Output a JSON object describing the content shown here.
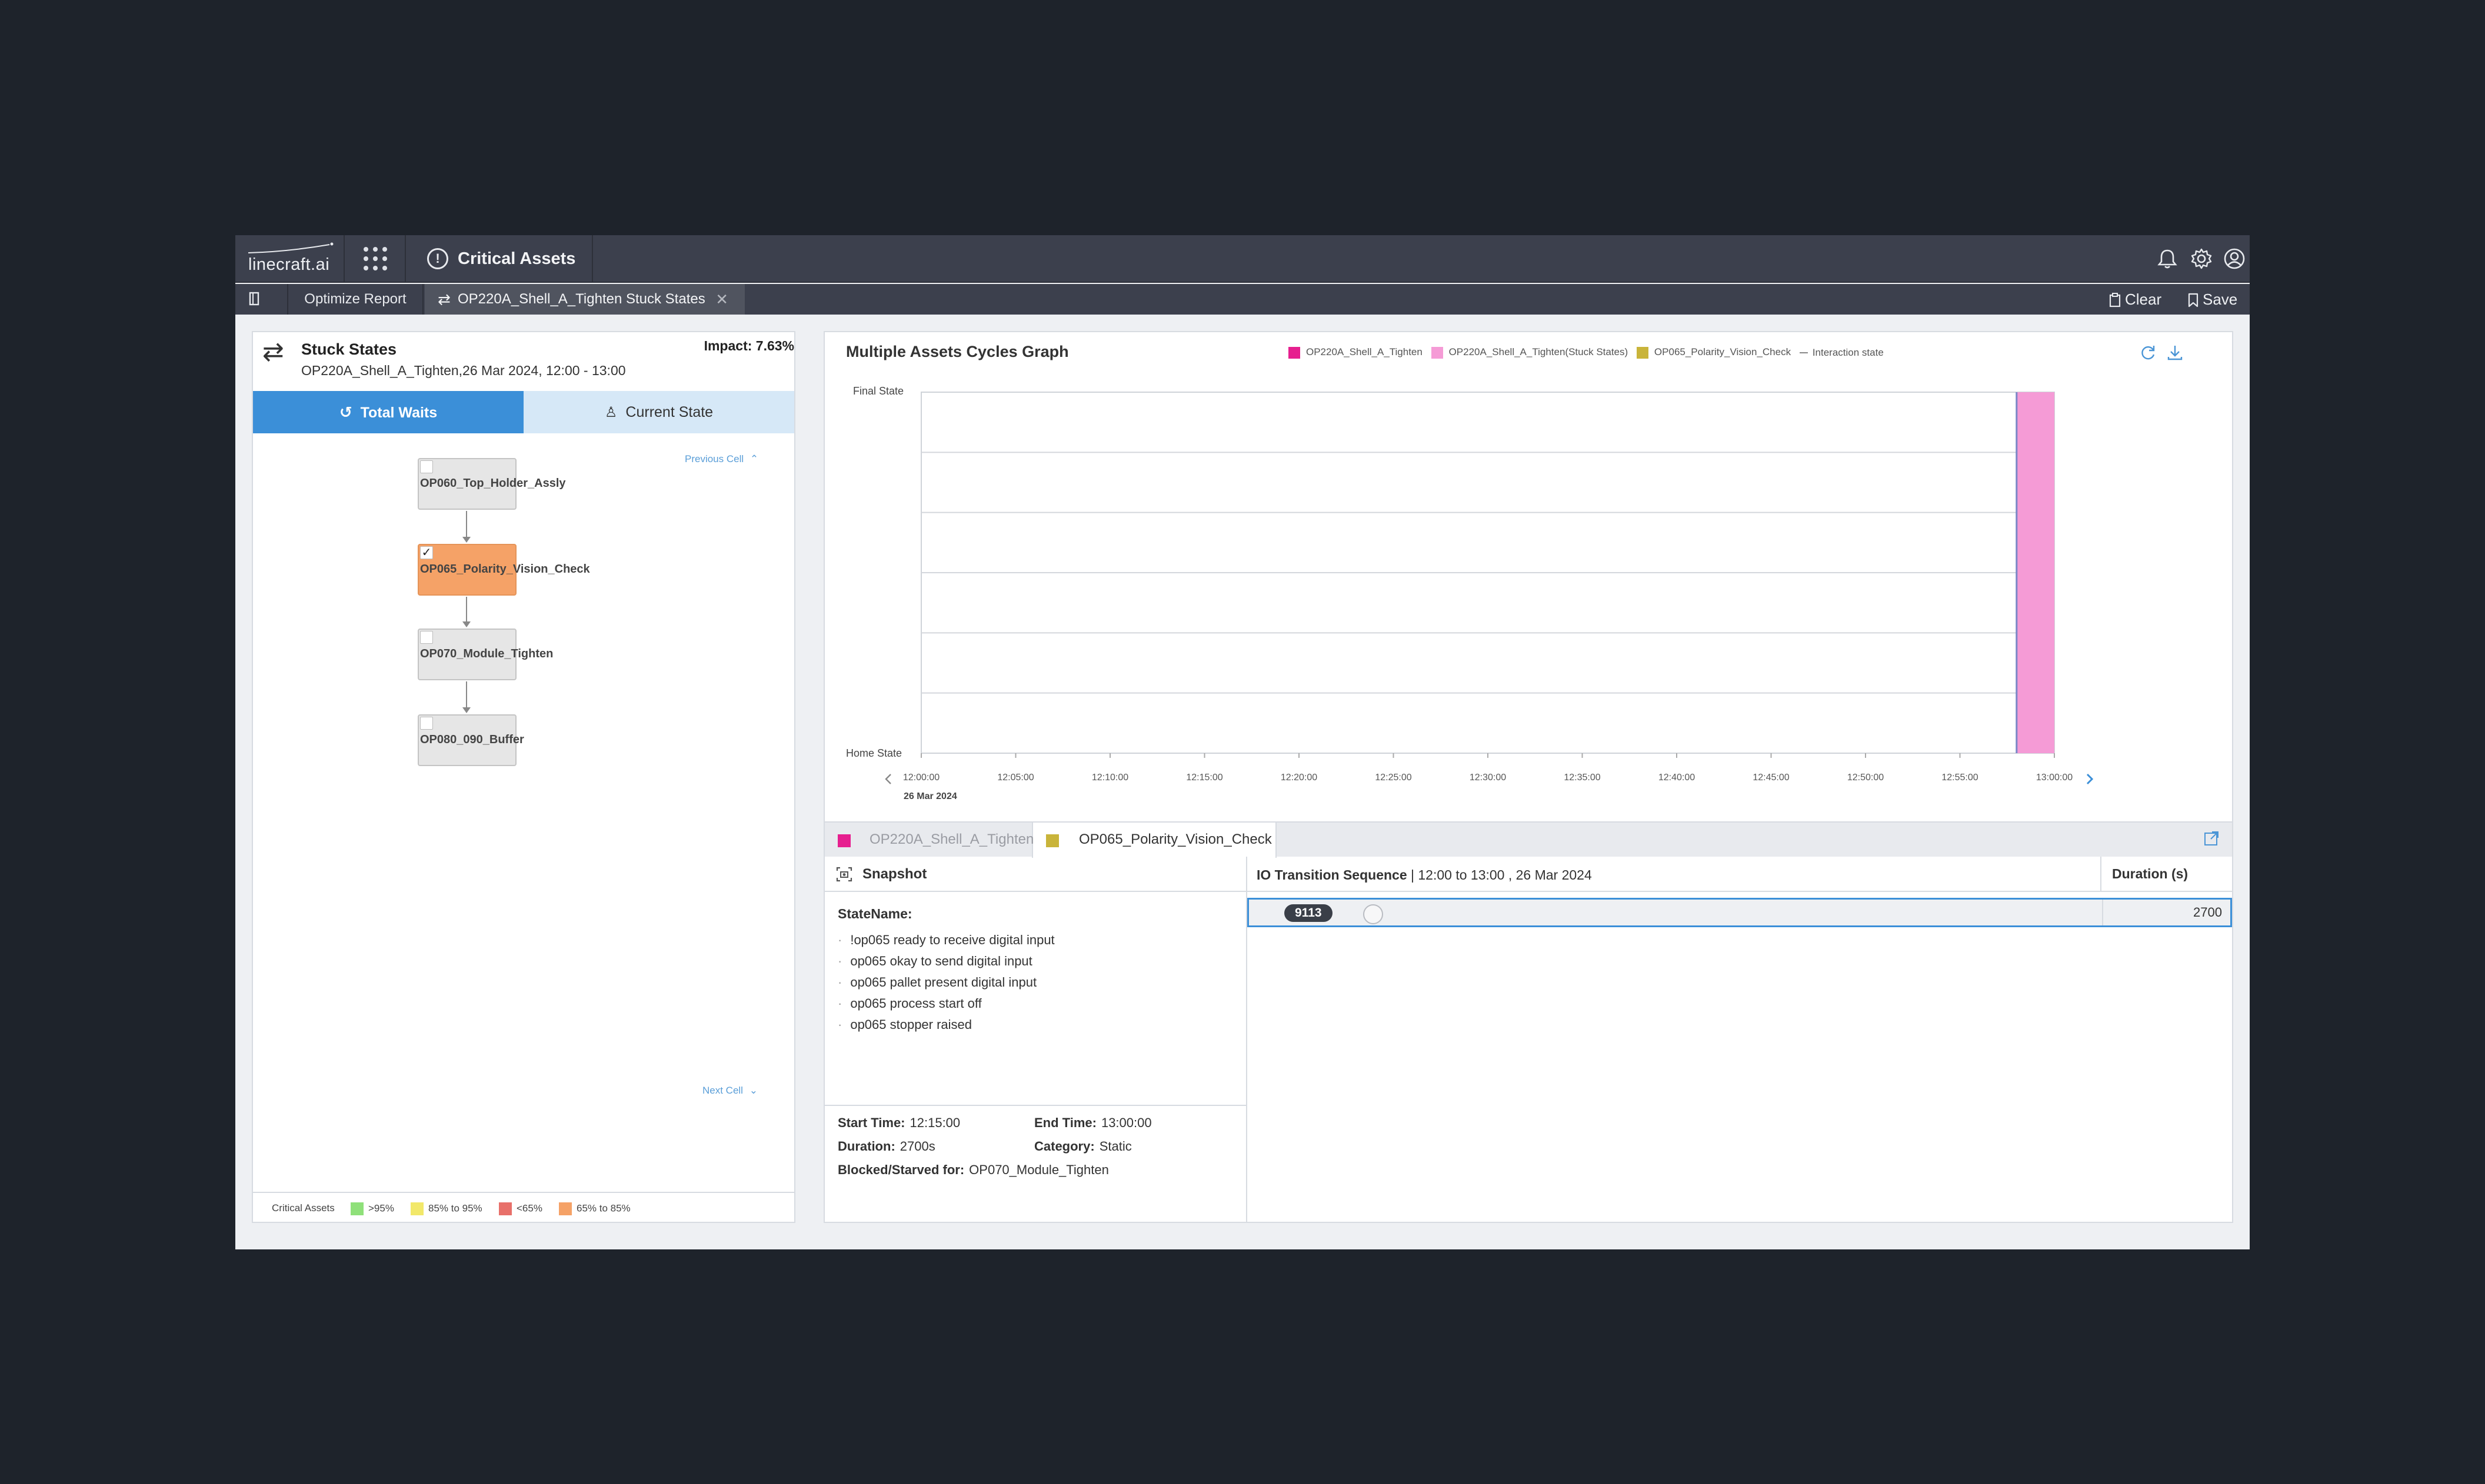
{
  "app": {
    "logo_text": "linecraft.ai",
    "module_title": "Critical Assets"
  },
  "tabs": {
    "optimize_label": "Optimize Report",
    "active_label": "OP220A_Shell_A_Tighten Stuck States",
    "clear_label": "Clear",
    "save_label": "Save"
  },
  "stuck": {
    "title": "Stuck States",
    "subtitle": "OP220A_Shell_A_Tighten,26 Mar 2024, 12:00 - 13:00",
    "impact": "Impact: 7.63%"
  },
  "left_tabs": {
    "total_waits": "Total Waits",
    "current_state": "Current State"
  },
  "flow": {
    "previous_cell": "Previous Cell",
    "next_cell": "Next Cell",
    "nodes": [
      {
        "name": "OP060_Top_Holder_Assly",
        "checked": false,
        "selected": false
      },
      {
        "name": "OP065_Polarity_Vision_Check",
        "checked": true,
        "selected": true
      },
      {
        "name": "OP070_Module_Tighten",
        "checked": false,
        "selected": false
      },
      {
        "name": "OP080_090_Buffer",
        "checked": false,
        "selected": false
      }
    ]
  },
  "critical_legend": {
    "title": "Critical Assets",
    "items": [
      {
        "label": ">95%",
        "color": "#8fe07a"
      },
      {
        "label": "85% to 95%",
        "color": "#f2e86a"
      },
      {
        "label": "<65%",
        "color": "#e8706a"
      },
      {
        "label": "65% to 85%",
        "color": "#f5a267"
      }
    ]
  },
  "graph": {
    "title": "Multiple Assets Cycles Graph",
    "legend": [
      {
        "label": "OP220A_Shell_A_Tighten",
        "color": "#e61f8f"
      },
      {
        "label": "OP220A_Shell_A_Tighten(Stuck States)",
        "color": "#f59bd6"
      },
      {
        "label": "OP065_Polarity_Vision_Check",
        "color": "#c9b43a"
      },
      {
        "label": "Interaction state",
        "color": "#888888",
        "line": true
      }
    ]
  },
  "chart_data": {
    "type": "area",
    "title": "Multiple Assets Cycles Graph",
    "y_categories": [
      "Home State",
      "Final State"
    ],
    "x_ticks": [
      "12:00:00",
      "12:05:00",
      "12:10:00",
      "12:15:00",
      "12:20:00",
      "12:25:00",
      "12:30:00",
      "12:35:00",
      "12:40:00",
      "12:45:00",
      "12:50:00",
      "12:55:00",
      "13:00:00"
    ],
    "x_date": "26 Mar 2024",
    "xlim": [
      "12:00:00",
      "13:00:00"
    ],
    "series": [
      {
        "name": "OP220A_Shell_A_Tighten(Stuck States)",
        "color": "#f59bd6",
        "x": [
          "12:58:00",
          "13:00:00"
        ],
        "state": "Final State"
      }
    ],
    "grid": true
  },
  "io": {
    "tab1_label": "OP220A_Shell_A_Tighten",
    "tab1_color": "#e61f8f",
    "tab2_label": "OP065_Polarity_Vision_Check",
    "tab2_color": "#c9b43a",
    "header_label": "IO Transition Sequence",
    "header_range": "| 12:00 to 13:00 , 26 Mar 2024",
    "duration_header": "Duration (s)",
    "rows": [
      {
        "id": "9113",
        "duration": "2700"
      }
    ]
  },
  "snapshot": {
    "title": "Snapshot",
    "state_name_label": "StateName:",
    "states": [
      "!op065 ready to receive digital input",
      "op065 okay to send digital input",
      "op065 pallet present digital input",
      "op065 process start off",
      "op065 stopper raised"
    ],
    "start_time_label": "Start Time:",
    "start_time": "12:15:00",
    "end_time_label": "End Time:",
    "end_time": "13:00:00",
    "duration_label": "Duration:",
    "duration": "2700s",
    "category_label": "Category:",
    "category": "Static",
    "blocked_label": "Blocked/Starved for:",
    "blocked": "OP070_Module_Tighten"
  }
}
